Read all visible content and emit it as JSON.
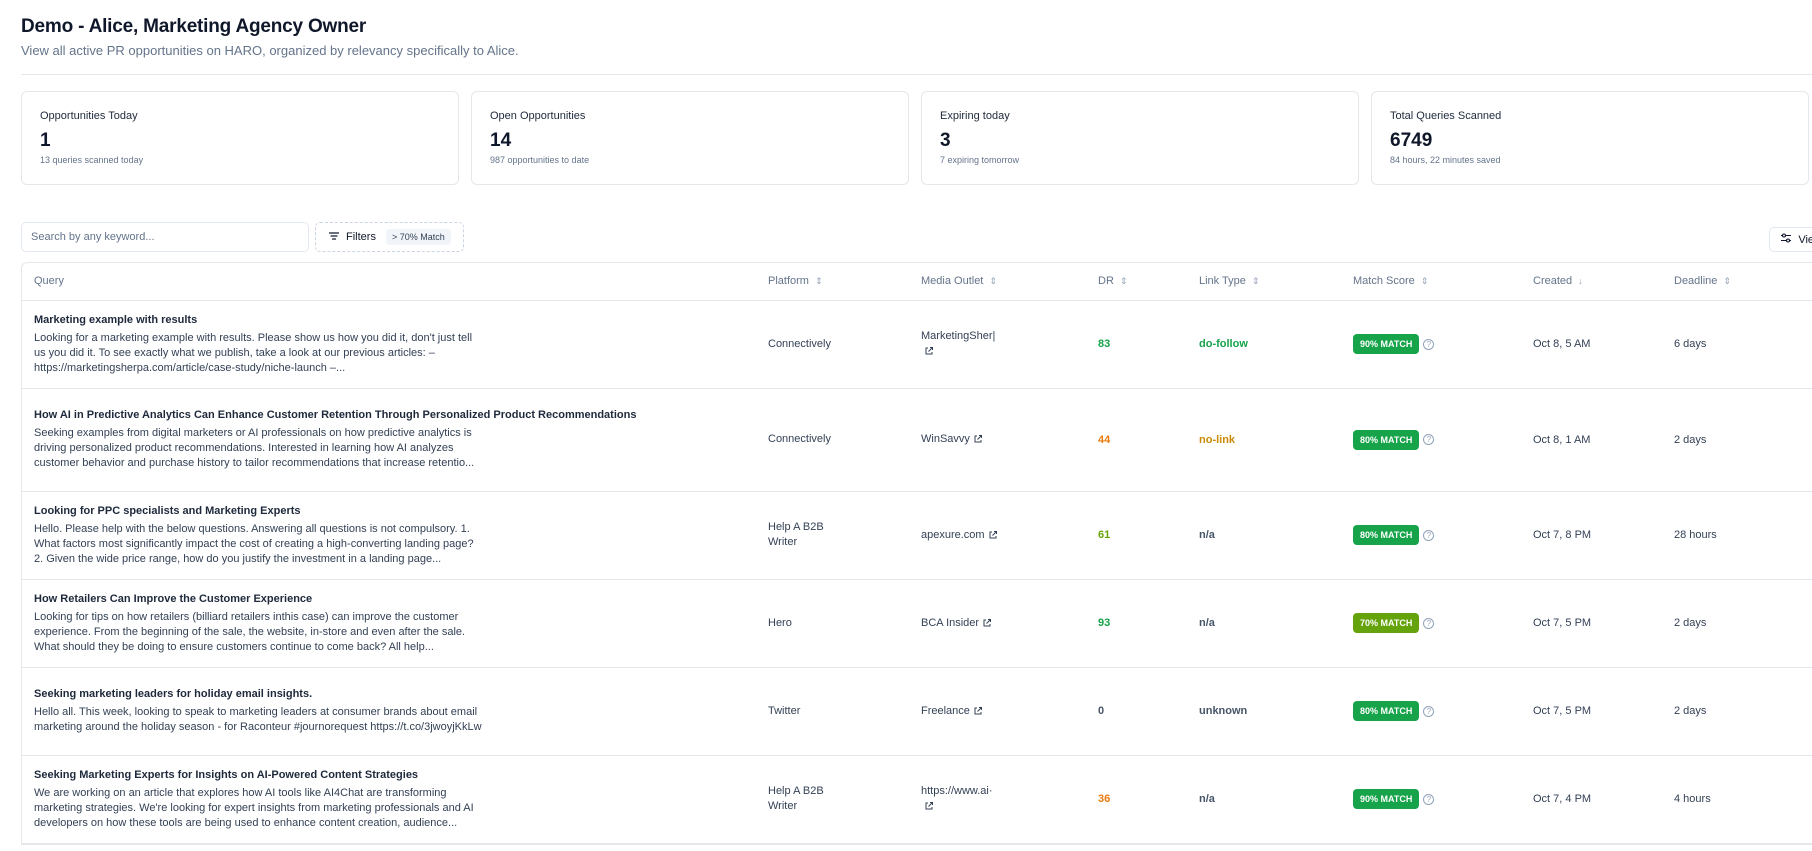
{
  "header": {
    "title": "Demo - Alice, Marketing Agency Owner",
    "subtitle": "View all active PR opportunities on HARO, organized by relevancy specifically to Alice."
  },
  "stats": [
    {
      "label": "Opportunities Today",
      "value": "1",
      "sub": "13 queries scanned today"
    },
    {
      "label": "Open Opportunities",
      "value": "14",
      "sub": "987 opportunities to date"
    },
    {
      "label": "Expiring today",
      "value": "3",
      "sub": "7 expiring tomorrow"
    },
    {
      "label": "Total Queries Scanned",
      "value": "6749",
      "sub": "84 hours, 22 minutes saved"
    }
  ],
  "toolbar": {
    "search_placeholder": "Search by any keyword...",
    "filters_label": "Filters",
    "filter_badge": "> 70% Match",
    "view_label": "View"
  },
  "table": {
    "columns": {
      "query": "Query",
      "platform": "Platform",
      "outlet": "Media Outlet",
      "dr": "DR",
      "link_type": "Link Type",
      "match": "Match Score",
      "created": "Created",
      "deadline": "Deadline"
    },
    "rows": [
      {
        "title": "Marketing example with results",
        "desc": "Looking for a marketing example with results. Please show us how you did it, don't just tell us you did it. To see exactly what we publish, take a look at our previous articles: – https://marketingsherpa.com/article/case-study/niche-launch –...",
        "platform": "Connectively",
        "outlet": "MarketingSher|",
        "dr": "83",
        "link_type": "do-follow",
        "match": "90% MATCH",
        "created": "Oct 8, 5 AM",
        "deadline": "6 days"
      },
      {
        "title": "How AI in Predictive Analytics Can Enhance Customer Retention Through Personalized Product Recommendations",
        "desc": "Seeking examples from digital marketers or AI professionals on how predictive analytics is driving personalized product recommendations. Interested in learning how AI analyzes customer behavior and purchase history to tailor recommendations that increase retentio...",
        "platform": "Connectively",
        "outlet": "WinSavvy",
        "dr": "44",
        "link_type": "no-link",
        "match": "80% MATCH",
        "created": "Oct 8, 1 AM",
        "deadline": "2 days"
      },
      {
        "title": "Looking for PPC specialists and Marketing Experts",
        "desc": "Hello. Please help with the below questions. Answering all questions is not compulsory. 1. What factors most significantly impact the cost of creating a high-converting landing page? 2. Given the wide price range, how do you justify the investment in a landing page...",
        "platform": "Help A B2B Writer",
        "outlet": "apexure.com",
        "dr": "61",
        "link_type": "n/a",
        "match": "80% MATCH",
        "created": "Oct 7, 8 PM",
        "deadline": "28 hours"
      },
      {
        "title": "How Retailers Can Improve the Customer Experience",
        "desc": "Looking for tips on how retailers (billiard retailers inthis case) can improve the customer experience. From the beginning of the sale, the website, in-store and even after the sale. What should they be doing to ensure customers continue to come back? All help...",
        "platform": "Hero",
        "outlet": "BCA Insider",
        "dr": "93",
        "link_type": "n/a",
        "match": "70% MATCH",
        "created": "Oct 7, 5 PM",
        "deadline": "2 days"
      },
      {
        "title": "Seeking marketing leaders for holiday email insights.",
        "desc": "Hello all. This week, looking to speak to marketing leaders at consumer brands about email marketing around the holiday season - for Raconteur #journorequest https://t.co/3jwoyjKkLw",
        "platform": "Twitter",
        "outlet": "Freelance",
        "dr": "0",
        "link_type": "unknown",
        "match": "80% MATCH",
        "created": "Oct 7, 5 PM",
        "deadline": "2 days"
      },
      {
        "title": "Seeking Marketing Experts for Insights on AI-Powered Content Strategies",
        "desc": "We are working on an article that explores how AI tools like AI4Chat are transforming marketing strategies. We're looking for expert insights from marketing professionals and AI developers on how these tools are being used to enhance content creation, audience...",
        "platform": "Help A B2B Writer",
        "outlet": "https://www.ai·",
        "dr": "36",
        "link_type": "n/a",
        "match": "90% MATCH",
        "created": "Oct 7, 4 PM",
        "deadline": "4 hours"
      }
    ]
  },
  "colors": {
    "dr_high": "#16a34a",
    "dr_mid": "#65a30d",
    "dr_low": "#ea7a0c",
    "dr_zero": "#475569",
    "do_follow": "#16a34a",
    "no_link": "#ca8a04",
    "neutral_link": "#475569",
    "match_90": "#16a34a",
    "match_80": "#16a34a",
    "match_70": "#65a30d"
  }
}
